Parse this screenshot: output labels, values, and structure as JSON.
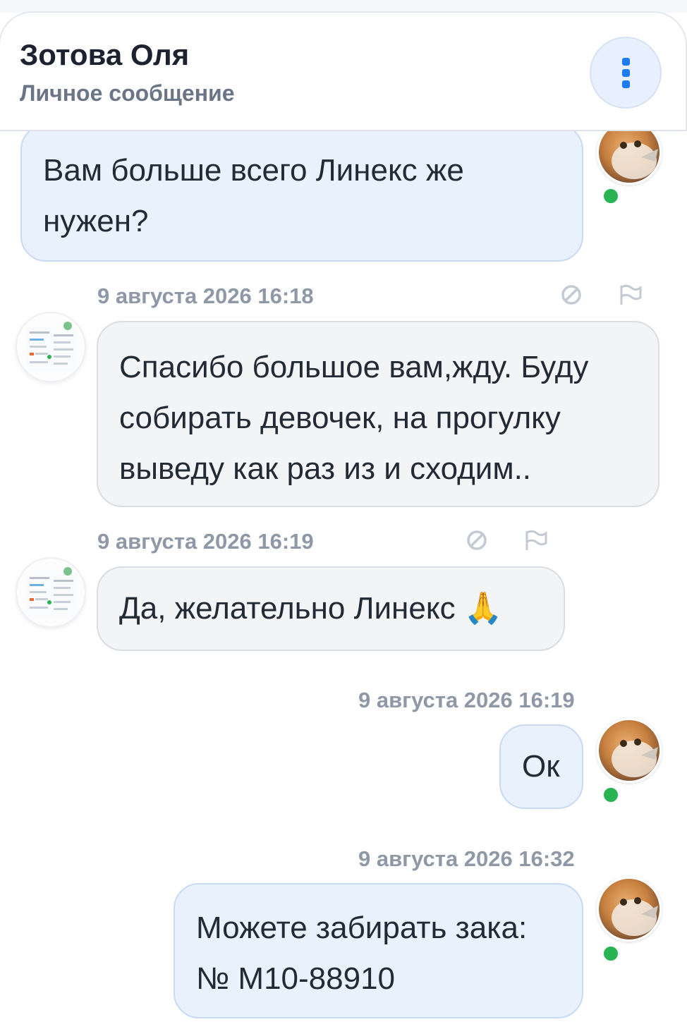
{
  "header": {
    "name": "Зотова Оля",
    "subtitle": "Личное сообщение",
    "menu_icon": "kebab-menu-icon",
    "accent_color": "#1a7cf0"
  },
  "messages": [
    {
      "direction": "out",
      "text": "Вам больше всего Линекс же\nнужен?"
    },
    {
      "direction": "in",
      "timestamp": "9 августа 2026 16:18",
      "text": "Спасибо большое вам,жду. Буду\nсобирать девочек, на прогулку\nвыведу как раз из и сходим.."
    },
    {
      "direction": "in",
      "timestamp": "9 августа 2026 16:19",
      "text": "Да, желательно Линекс 🙏"
    },
    {
      "direction": "out",
      "timestamp": "9 августа 2026 16:19",
      "text": "Ок"
    },
    {
      "direction": "out",
      "timestamp": "9 августа 2026 16:32",
      "text": "Можете забирать зака:\n№ М10-88910"
    }
  ],
  "icons": {
    "block": "block-icon",
    "report": "flag-icon",
    "online": "online-status-dot"
  },
  "colors": {
    "outgoing_bubble": "#e9f1fc",
    "incoming_bubble": "#f3f4f6",
    "online": "#2ab352"
  }
}
